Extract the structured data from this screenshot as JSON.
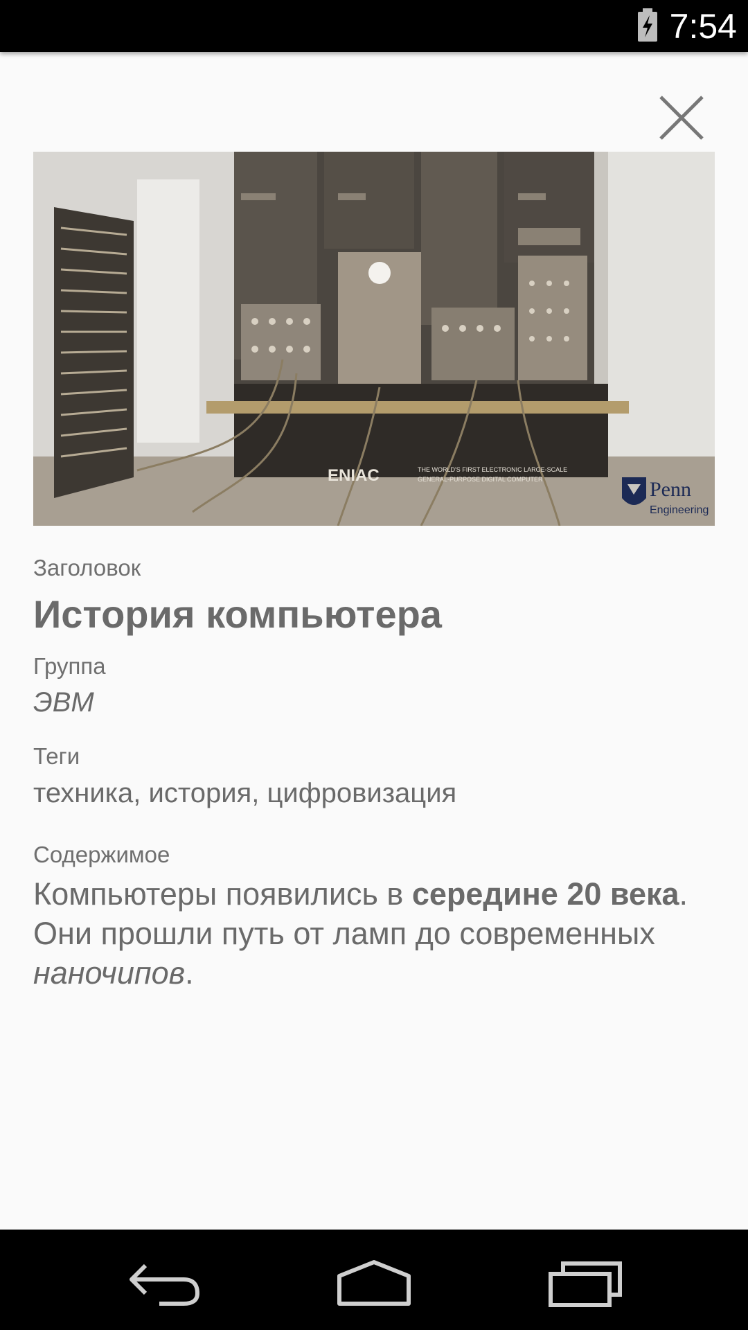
{
  "status_bar": {
    "time": "7:54",
    "battery_icon": "battery-charging-icon"
  },
  "close_icon": "close-icon",
  "photo": {
    "sign_left": "ENIAC",
    "sign_right_line1": "THE WORLD'S FIRST ELECTRONIC LARGE-SCALE",
    "sign_right_line2": "GENERAL-PURPOSE DIGITAL COMPUTER",
    "logo_text_1": "Penn",
    "logo_text_2": "Engineering"
  },
  "fields": {
    "title_label": "Заголовок",
    "title_value": "История компьютера",
    "group_label": "Группа",
    "group_value": "ЭВМ",
    "tags_label": "Теги",
    "tags_value": "техника, история, цифровизация",
    "content_label": "Содержимое",
    "content_parts": {
      "p1": "Компьютеры появились в ",
      "p2_bold": "середине 20 века",
      "p3": ". Они прошли путь от ламп до современных ",
      "p4_italic": "наночипов",
      "p5": "."
    }
  },
  "nav_bar": {
    "back_icon": "back-icon",
    "home_icon": "home-icon",
    "recents_icon": "recents-icon"
  }
}
